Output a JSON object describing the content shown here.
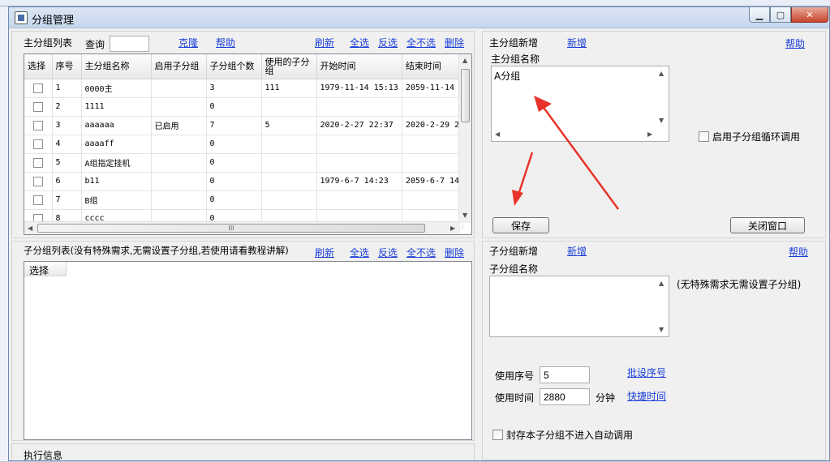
{
  "window": {
    "title": "分组管理"
  },
  "main_list": {
    "title": "主分组列表",
    "query_label": "查询",
    "query_value": "",
    "links": {
      "clone": "克隆",
      "help": "帮助",
      "refresh": "刷新",
      "select_all": "全选",
      "invert": "反选",
      "select_none": "全不选",
      "delete": "删除"
    },
    "columns": [
      "选择",
      "序号",
      "主分组名称",
      "启用子分组",
      "子分组个数",
      "使用的子分组",
      "开始时间",
      "结束时间"
    ],
    "rows": [
      {
        "id": "1",
        "name": "0000主",
        "enabled": "",
        "count": "3",
        "used": "111",
        "start": "1979-11-14 15:13",
        "end": "2059-11-14"
      },
      {
        "id": "2",
        "name": "1111",
        "enabled": "",
        "count": "0",
        "used": "",
        "start": "",
        "end": ""
      },
      {
        "id": "3",
        "name": "aaaaaa",
        "enabled": "已启用",
        "count": "7",
        "used": "5",
        "start": "2020-2-27 22:37",
        "end": "2020-2-29 2"
      },
      {
        "id": "4",
        "name": "aaaaff",
        "enabled": "",
        "count": "0",
        "used": "",
        "start": "",
        "end": ""
      },
      {
        "id": "5",
        "name": "A组指定挂机",
        "enabled": "",
        "count": "0",
        "used": "",
        "start": "",
        "end": ""
      },
      {
        "id": "6",
        "name": "b11",
        "enabled": "",
        "count": "0",
        "used": "",
        "start": "1979-6-7 14:23",
        "end": "2059-6-7 14"
      },
      {
        "id": "7",
        "name": "B组",
        "enabled": "",
        "count": "0",
        "used": "",
        "start": "",
        "end": ""
      },
      {
        "id": "8",
        "name": "cccc",
        "enabled": "",
        "count": "0",
        "used": "",
        "start": "",
        "end": ""
      }
    ],
    "hscroll_grip": "III"
  },
  "main_new": {
    "title": "主分组新增",
    "new_link": "新增",
    "help_link": "帮助",
    "name_label": "主分组名称",
    "name_value": "A分组",
    "cycle_label": "启用子分组循环调用",
    "save_button": "保存",
    "close_button": "关闭窗口"
  },
  "sub_list": {
    "title": "子分组列表(没有特殊需求,无需设置子分组,若使用请看教程讲解)",
    "links": {
      "refresh": "刷新",
      "select_all": "全选",
      "invert": "反选",
      "select_none": "全不选",
      "delete": "删除"
    },
    "column": "选择"
  },
  "sub_new": {
    "title": "子分组新增",
    "new_link": "新增",
    "help_link": "帮助",
    "name_label": "子分组名称",
    "hint": "(无特殊需求无需设置子分组)",
    "seq_label": "使用序号",
    "seq_value": "5",
    "batch_link": "批设序号",
    "time_label": "使用时间",
    "time_value": "2880",
    "minute_label": "分钟",
    "quick_link": "快捷时间",
    "seal_label": "封存本子分组不进入自动调用"
  },
  "exec_info": {
    "title": "执行信息"
  },
  "colors": {
    "link": "#1a3fd8",
    "arrow": "#e8332a",
    "title_bg": "#c5d6ec"
  }
}
